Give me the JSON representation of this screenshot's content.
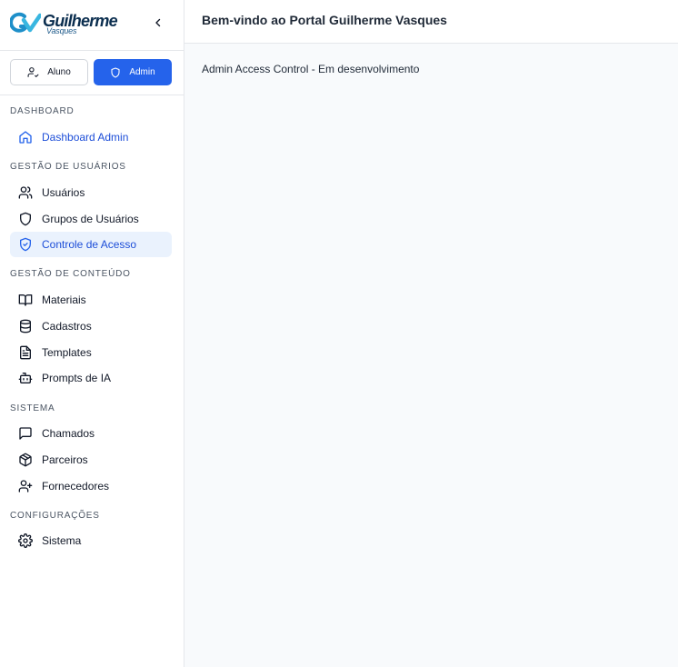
{
  "brand": {
    "name": "Guilherme",
    "subtitle": "Vasques",
    "color": "#0b2e4f"
  },
  "roles": {
    "aluno_label": "Aluno",
    "admin_label": "Admin",
    "active": "Admin",
    "accent": "#2563eb"
  },
  "sections": {
    "dashboard": "DASHBOARD",
    "users": "GESTÃO DE USUÁRIOS",
    "content": "GESTÃO DE CONTEÚDO",
    "system": "SISTEMA",
    "config": "CONFIGURAÇÕES"
  },
  "nav": {
    "dashboard_admin": {
      "label": "Dashboard Admin",
      "icon": "home-icon"
    },
    "usuarios": {
      "label": "Usuários",
      "icon": "users-icon"
    },
    "grupos": {
      "label": "Grupos de Usuários",
      "icon": "shield-icon"
    },
    "controle": {
      "label": "Controle de Acesso",
      "icon": "shield-check-icon",
      "active": true
    },
    "materiais": {
      "label": "Materiais",
      "icon": "book-open-icon"
    },
    "cadastros": {
      "label": "Cadastros",
      "icon": "database-icon"
    },
    "templates": {
      "label": "Templates",
      "icon": "file-text-icon"
    },
    "prompts": {
      "label": "Prompts de IA",
      "icon": "bot-icon"
    },
    "chamados": {
      "label": "Chamados",
      "icon": "message-square-icon"
    },
    "parceiros": {
      "label": "Parceiros",
      "icon": "package-icon"
    },
    "fornecedores": {
      "label": "Fornecedores",
      "icon": "user-plus-icon"
    },
    "sistema": {
      "label": "Sistema",
      "icon": "settings-icon"
    }
  },
  "header": {
    "title": "Bem-vindo ao Portal Guilherme Vasques"
  },
  "main": {
    "message": "Admin Access Control - Em desenvolvimento"
  }
}
